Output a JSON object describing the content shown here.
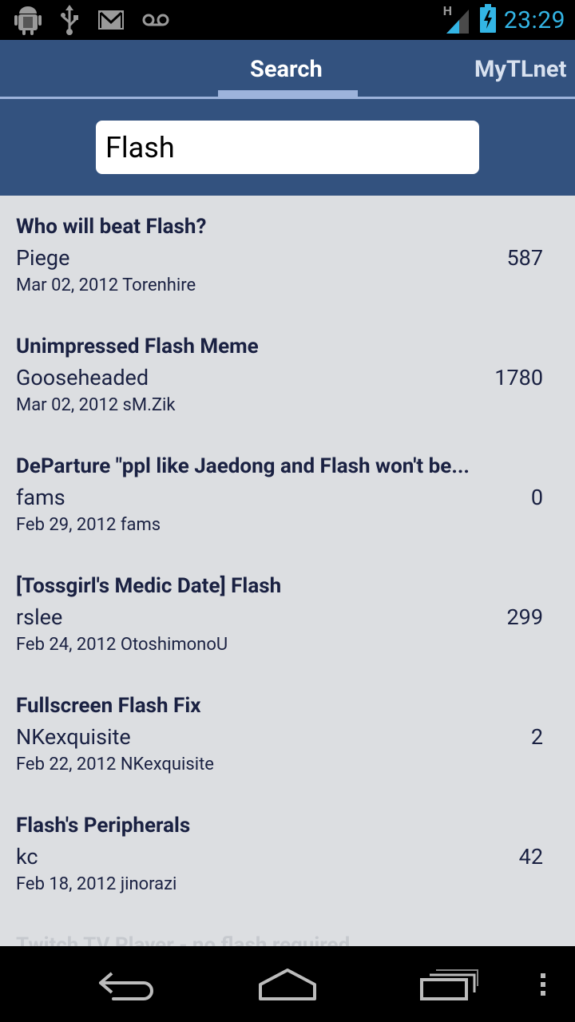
{
  "status_bar": {
    "icons": [
      "android-debug-icon",
      "usb-icon",
      "gmail-icon",
      "voicemail-icon",
      "signal-icon",
      "battery-charging-icon"
    ],
    "network_label": "H",
    "time": "23:29"
  },
  "tabs": [
    {
      "label": "Search",
      "active": true
    },
    {
      "label": "MyTLnet",
      "active": false
    }
  ],
  "search": {
    "value": "Flash"
  },
  "results": [
    {
      "title": "Who will beat Flash?",
      "author": "Piege",
      "count": "587",
      "meta": "Mar 02, 2012 Torenhire"
    },
    {
      "title": "Unimpressed Flash Meme",
      "author": "Gooseheaded",
      "count": "1780",
      "meta": "Mar 02, 2012 sM.Zik"
    },
    {
      "title": "DeParture \"ppl like Jaedong and Flash won't be...",
      "author": "fams",
      "count": "0",
      "meta": "Feb 29, 2012 fams"
    },
    {
      "title": "[Tossgirl's Medic Date] Flash",
      "author": "rslee",
      "count": "299",
      "meta": "Feb 24, 2012 OtoshimonoU"
    },
    {
      "title": "Fullscreen Flash Fix",
      "author": "NKexquisite",
      "count": "2",
      "meta": "Feb 22, 2012 NKexquisite"
    },
    {
      "title": "Flash's Peripherals",
      "author": "kc",
      "count": "42",
      "meta": "Feb 18, 2012 jinorazi"
    },
    {
      "title": "Twitch TV Player - no flash required",
      "author": "",
      "count": "",
      "meta": ""
    }
  ],
  "nav_bar": {
    "icons": [
      "back-icon",
      "home-icon",
      "recent-apps-icon",
      "overflow-menu-icon"
    ]
  },
  "colors": {
    "accent": "#33527f",
    "tab_indicator": "#9db3db",
    "clock": "#33b5e5",
    "list_bg": "#dcdee1",
    "text": "#1a2142"
  }
}
